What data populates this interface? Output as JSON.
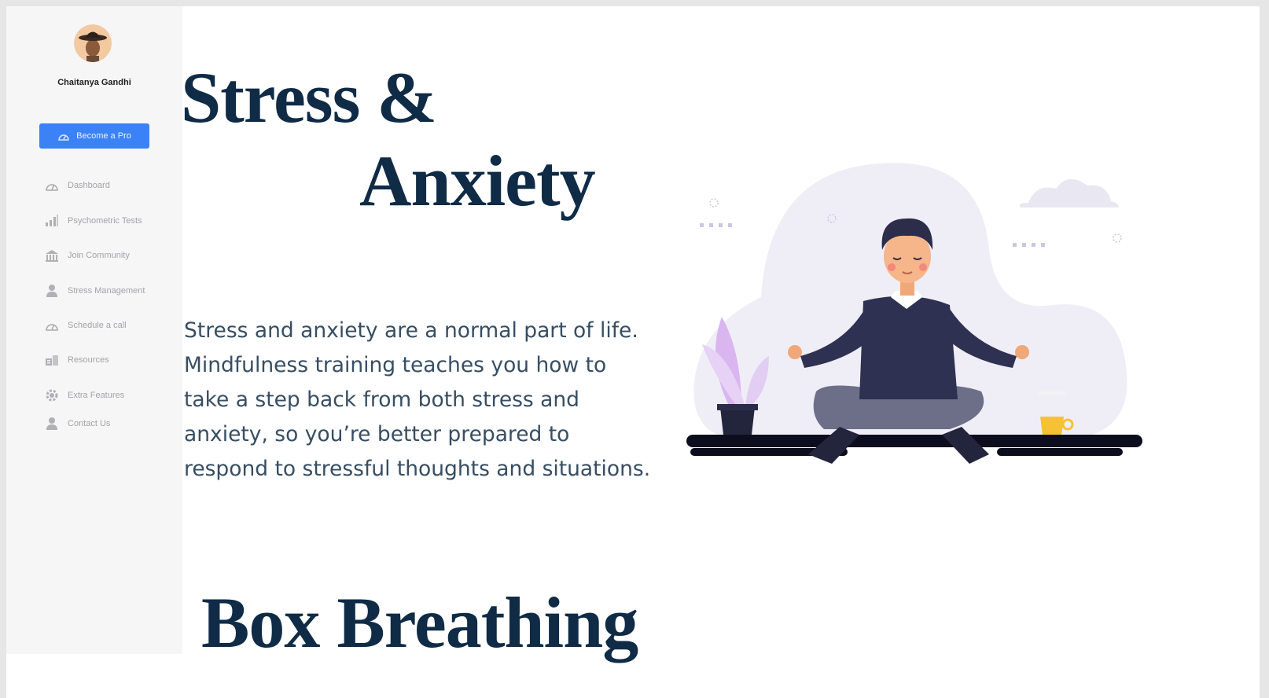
{
  "user": {
    "name": "Chaitanya Gandhi"
  },
  "sidebar": {
    "cta_label": "Become a Pro",
    "items": [
      {
        "label": "Dashboard",
        "icon": "dashboard-icon"
      },
      {
        "label": "Psychometric Tests",
        "icon": "chart-icon"
      },
      {
        "label": "Join Community",
        "icon": "community-icon"
      },
      {
        "label": "Stress Management",
        "icon": "user-icon"
      },
      {
        "label": "Schedule a call",
        "icon": "gauge-icon"
      },
      {
        "label": "Resources",
        "icon": "resources-icon"
      },
      {
        "label": "Extra Features",
        "icon": "gear-icon"
      },
      {
        "label": "Contact Us",
        "icon": "user-icon"
      }
    ]
  },
  "main": {
    "title_line1": "Stress &",
    "title_line2": "Anxiety",
    "description": "Stress and anxiety are a normal part of life. Mindfulness training teaches you how to take a step back from both stress and anxiety, so you’re better prepared to respond to stressful thoughts and situations.",
    "section_title": "Box Breathing"
  },
  "colors": {
    "accent": "#3b82f6",
    "heading": "#0f2b46",
    "body_text": "#374e63",
    "sidebar_bg": "#f6f6f7"
  }
}
